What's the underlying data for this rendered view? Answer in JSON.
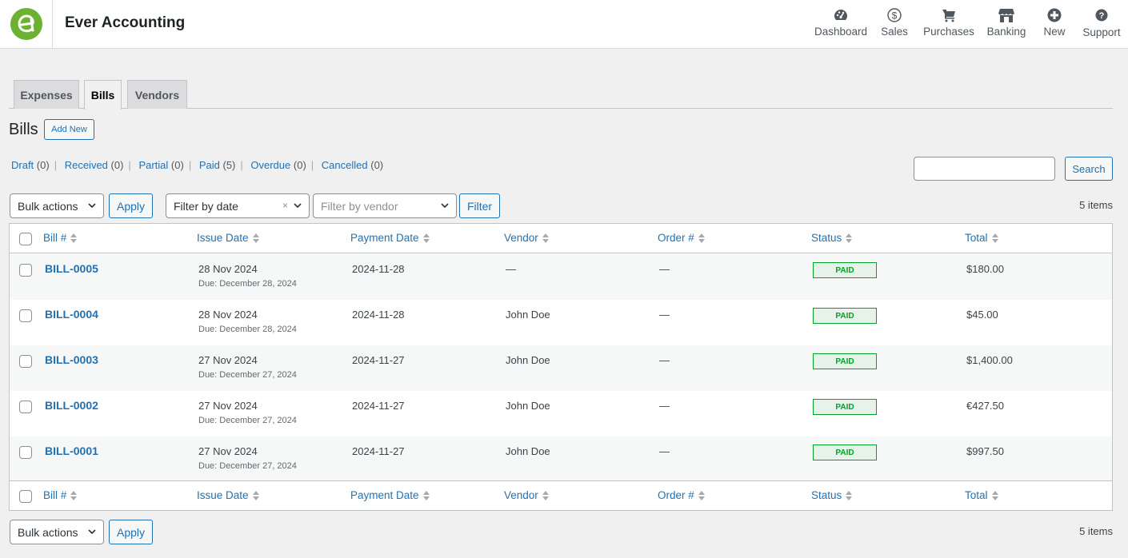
{
  "header": {
    "app_title": "Ever Accounting",
    "nav": [
      {
        "label": "Dashboard",
        "icon": "dashboard-gauge-icon"
      },
      {
        "label": "Sales",
        "icon": "dollar-circle-icon"
      },
      {
        "label": "Purchases",
        "icon": "cart-icon"
      },
      {
        "label": "Banking",
        "icon": "store-icon"
      },
      {
        "label": "New",
        "icon": "plus-circle-icon"
      },
      {
        "label": "Support",
        "icon": "help-circle-icon"
      }
    ]
  },
  "tabs": [
    {
      "label": "Expenses",
      "active": false
    },
    {
      "label": "Bills",
      "active": true
    },
    {
      "label": "Vendors",
      "active": false
    }
  ],
  "page": {
    "title": "Bills",
    "add_new_label": "Add New"
  },
  "status_filters": [
    {
      "label": "Draft",
      "count": "(0)"
    },
    {
      "label": "Received",
      "count": "(0)"
    },
    {
      "label": "Partial",
      "count": "(0)"
    },
    {
      "label": "Paid",
      "count": "(5)"
    },
    {
      "label": "Overdue",
      "count": "(0)"
    },
    {
      "label": "Cancelled",
      "count": "(0)"
    }
  ],
  "search": {
    "value": "",
    "button_label": "Search"
  },
  "toolbar_top": {
    "bulk_actions": "Bulk actions",
    "apply_label": "Apply",
    "date_filter": "Filter by date",
    "date_filter_clear": "×",
    "vendor_filter_placeholder": "Filter by vendor",
    "filter_label": "Filter",
    "items_count": "5 items"
  },
  "toolbar_bottom": {
    "bulk_actions": "Bulk actions",
    "apply_label": "Apply",
    "items_count": "5 items"
  },
  "table": {
    "columns": [
      "Bill #",
      "Issue Date",
      "Payment Date",
      "Vendor",
      "Order #",
      "Status",
      "Total"
    ],
    "rows": [
      {
        "bill": "BILL-0005",
        "issue_date": "28 Nov 2024",
        "due": "Due: December 28, 2024",
        "payment_date": "2024-11-28",
        "vendor": "—",
        "vendor_link": false,
        "order": "—",
        "status": "PAID",
        "total": "$180.00"
      },
      {
        "bill": "BILL-0004",
        "issue_date": "28 Nov 2024",
        "due": "Due: December 28, 2024",
        "payment_date": "2024-11-28",
        "vendor": "John Doe",
        "vendor_link": true,
        "order": "—",
        "status": "PAID",
        "total": "$45.00"
      },
      {
        "bill": "BILL-0003",
        "issue_date": "27 Nov 2024",
        "due": "Due: December 27, 2024",
        "payment_date": "2024-11-27",
        "vendor": "John Doe",
        "vendor_link": true,
        "order": "—",
        "status": "PAID",
        "total": "$1,400.00"
      },
      {
        "bill": "BILL-0002",
        "issue_date": "27 Nov 2024",
        "due": "Due: December 27, 2024",
        "payment_date": "2024-11-27",
        "vendor": "John Doe",
        "vendor_link": true,
        "order": "—",
        "status": "PAID",
        "total": "€427.50"
      },
      {
        "bill": "BILL-0001",
        "issue_date": "27 Nov 2024",
        "due": "Due: December 27, 2024",
        "payment_date": "2024-11-27",
        "vendor": "John Doe",
        "vendor_link": true,
        "order": "—",
        "status": "PAID",
        "total": "$997.50"
      }
    ]
  },
  "colors": {
    "brand_green": "#6cb131",
    "link_blue": "#2271b1",
    "paid_green": "#00a32a",
    "paid_bg": "#e7f2e8"
  }
}
